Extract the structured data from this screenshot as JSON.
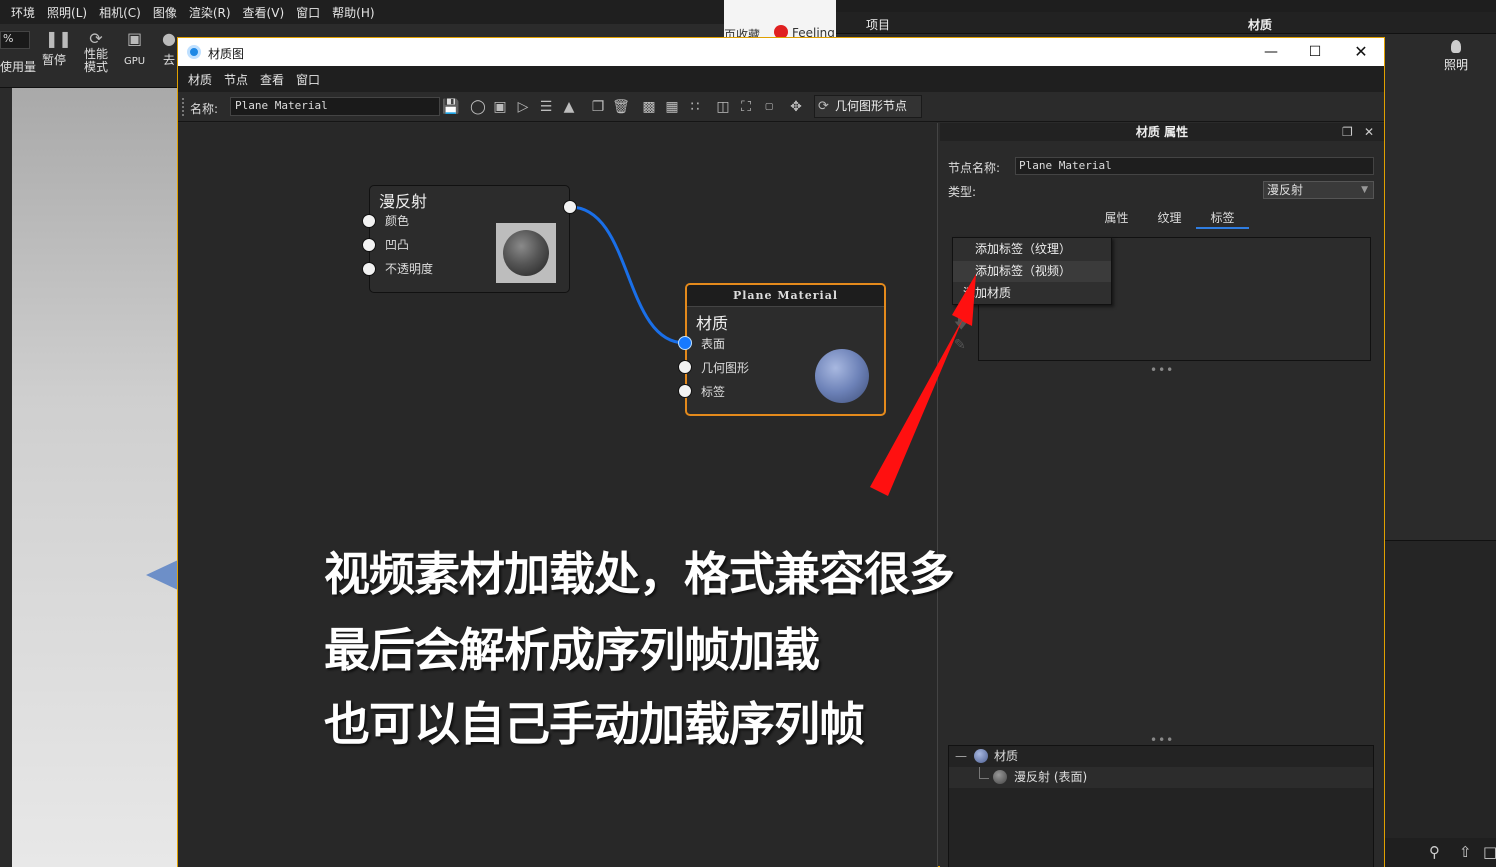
{
  "bg_app": {
    "menu": [
      "环境",
      "照明(L)",
      "相机(C)",
      "图像",
      "渲染(R)",
      "查看(V)",
      "窗口",
      "帮助(H)"
    ],
    "percent_field": "%",
    "tools": {
      "usage": "使用量",
      "pause": "暂停",
      "perf_line1": "性能",
      "perf_line2": "模式",
      "gpu": "GPU",
      "go": "去"
    },
    "browser_tab1": "页收藏",
    "browser_tab2": "Feeling",
    "right_header_project": "项目",
    "right_header_material": "材质",
    "light_label": "照明"
  },
  "window": {
    "title": "材质图",
    "menu": [
      "材质",
      "节点",
      "查看",
      "窗口"
    ],
    "toolbar": {
      "name_label": "名称:",
      "name_value": "Plane Material",
      "geo_button": "几何图形节点"
    }
  },
  "graph": {
    "diffuse_node": {
      "title": "漫反射",
      "ports": [
        "颜色",
        "凹凸",
        "不透明度"
      ]
    },
    "material_node": {
      "header": "Plane Material",
      "title": "材质",
      "ports": [
        "表面",
        "几何图形",
        "标签"
      ]
    }
  },
  "props": {
    "title": "材质 属性",
    "node_name_label": "节点名称:",
    "node_name_value": "Plane Material",
    "type_label": "类型:",
    "type_value": "漫反射",
    "tabs": [
      "属性",
      "纹理",
      "标签"
    ],
    "active_tab": "标签",
    "context_menu": [
      "添加标签（纹理）",
      "添加标签（视频）",
      "添加材质"
    ],
    "tree": {
      "root": "材质",
      "child": "漫反射 (表面)"
    }
  },
  "annotation": {
    "line1": "视频素材加载处，格式兼容很多",
    "line2": "最后会解析成序列帧加载",
    "line3": "也可以自己手动加载序列帧"
  },
  "colors": {
    "wire": "#1a6fe8",
    "material_border": "#e48a1c",
    "arrow": "#ff1010",
    "window_border": "#e0a000",
    "active_tab": "#2f7de1"
  },
  "icons": [
    "pause-icon",
    "performance-icon",
    "gpu-icon",
    "save-icon",
    "bulb-icon",
    "minimize-icon",
    "maximize-icon",
    "close-icon"
  ]
}
